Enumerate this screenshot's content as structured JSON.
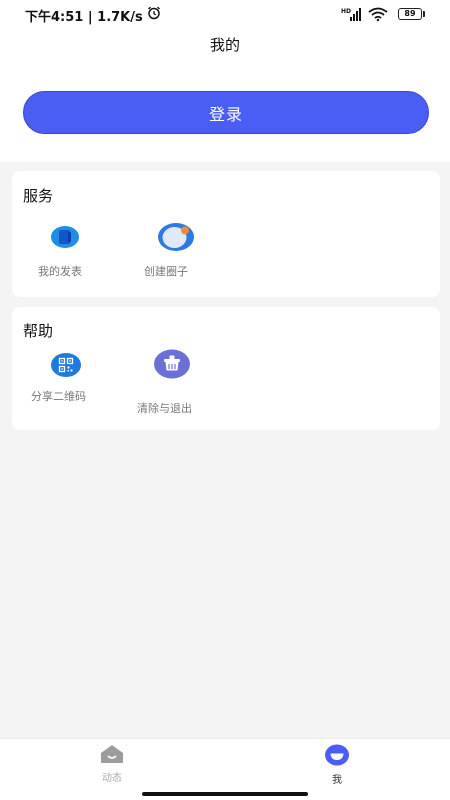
{
  "status_bar": {
    "time": "下午4:51",
    "speed": "1.7K/s",
    "network": "HD",
    "battery": "89"
  },
  "header": {
    "title": "我的",
    "login_label": "登录"
  },
  "services": {
    "title": "服务",
    "items": [
      {
        "label": "我的发表",
        "icon": "my-posts-icon"
      },
      {
        "label": "创建圈子",
        "icon": "create-circle-icon"
      }
    ]
  },
  "help": {
    "title": "帮助",
    "items": [
      {
        "label": "分享二维码",
        "icon": "qr-code-icon"
      },
      {
        "label": "清除与退出",
        "icon": "clear-basket-icon"
      }
    ]
  },
  "bottom_nav": {
    "items": [
      {
        "label": "动态",
        "icon": "home-icon",
        "active": false
      },
      {
        "label": "我",
        "icon": "profile-icon",
        "active": true
      }
    ]
  },
  "colors": {
    "primary": "#4a5ef5",
    "icon_blue": "#1f7ae0",
    "icon_orange": "#f08a3c",
    "icon_purple": "#6b70d6"
  }
}
